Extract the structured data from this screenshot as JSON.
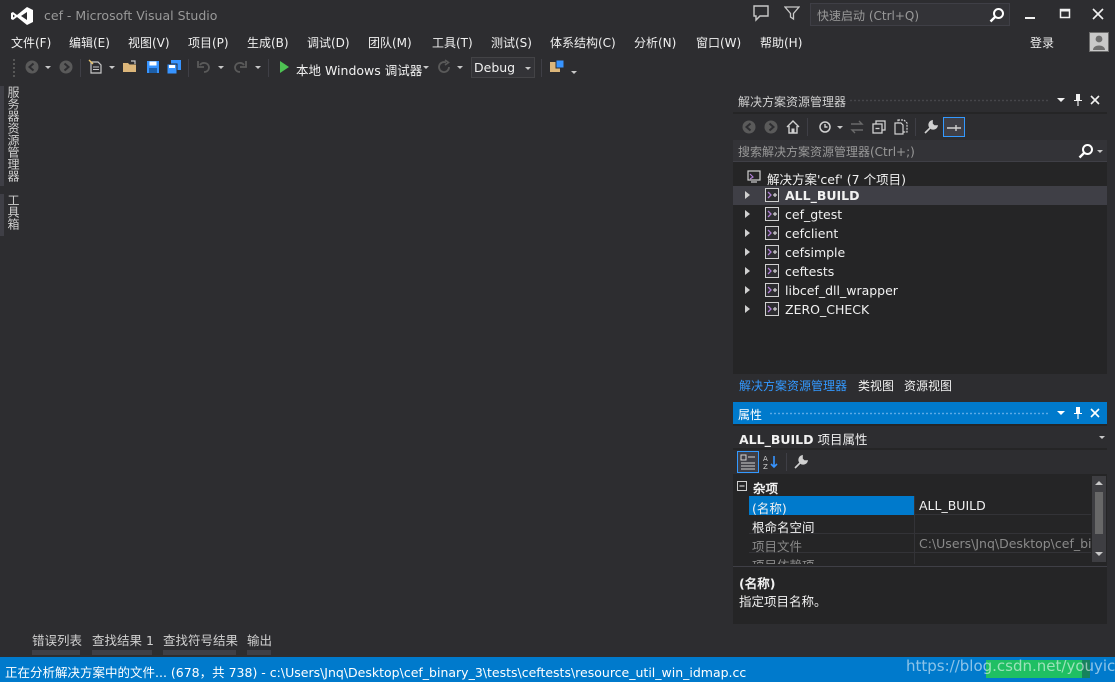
{
  "window": {
    "title": "cef - Microsoft Visual Studio",
    "quick_launch_placeholder": "快速启动 (Ctrl+Q)"
  },
  "menu": [
    "文件(F)",
    "编辑(E)",
    "视图(V)",
    "项目(P)",
    "生成(B)",
    "调试(D)",
    "团队(M)",
    "工具(T)",
    "测试(S)",
    "体系结构(C)",
    "分析(N)",
    "窗口(W)",
    "帮助(H)"
  ],
  "account": {
    "login_label": "登录"
  },
  "toolbar": {
    "start_debugger_label": "本地 Windows 调试器",
    "configuration": "Debug"
  },
  "left_tabs": [
    "服务器资源管理器",
    "工具箱"
  ],
  "solution_explorer": {
    "title": "解决方案资源管理器",
    "search_placeholder": "搜索解决方案资源管理器(Ctrl+;)",
    "solution_label": "解决方案'cef' (7 个项目)",
    "projects": [
      {
        "name": "ALL_BUILD",
        "selected": true
      },
      {
        "name": "cef_gtest"
      },
      {
        "name": "cefclient"
      },
      {
        "name": "cefsimple"
      },
      {
        "name": "ceftests"
      },
      {
        "name": "libcef_dll_wrapper"
      },
      {
        "name": "ZERO_CHECK"
      }
    ],
    "tabs": [
      "解决方案资源管理器",
      "类视图",
      "资源视图"
    ],
    "active_tab": "解决方案资源管理器"
  },
  "properties": {
    "title": "属性",
    "object_name": "ALL_BUILD",
    "object_type": "项目属性",
    "category": "杂项",
    "rows": [
      {
        "name": "(名称)",
        "value": "ALL_BUILD",
        "selected": true
      },
      {
        "name": "根命名空间",
        "value": ""
      },
      {
        "name": "项目文件",
        "value": "C:\\Users\\Jnq\\Desktop\\cef_bin",
        "dim": true
      },
      {
        "name": "项目依赖项",
        "value": "",
        "dim": true
      }
    ],
    "description_title": "(名称)",
    "description_text": "指定项目名称。"
  },
  "bottom_tabs": [
    "错误列表",
    "查找结果 1",
    "查找符号结果",
    "输出"
  ],
  "status": {
    "text": "正在分析解决方案中的文件... (678，共 738) - c:\\Users\\Jnq\\Desktop\\cef_binary_3\\tests\\ceftests\\resource_util_win_idmap.cc",
    "watermark": "https://blog.csdn.net/youyicc",
    "progress": 0.92
  },
  "colors": {
    "accent": "#007acc",
    "background": "#2d2d30",
    "panel": "#252526",
    "play_green": "#4ec253"
  }
}
